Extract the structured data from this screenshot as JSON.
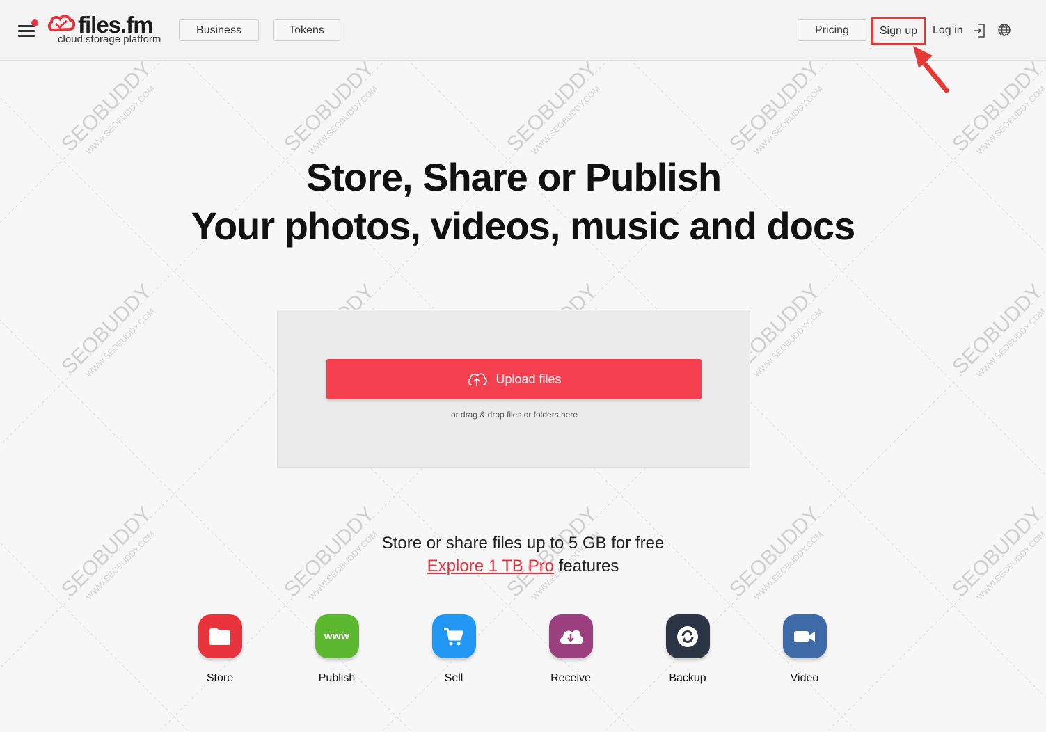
{
  "brand": {
    "name": "files.fm",
    "tagline": "cloud storage platform",
    "accent_color": "#f4404f"
  },
  "header": {
    "menu_icon": "hamburger-menu-icon",
    "nav_left": [
      "Business",
      "Tokens"
    ],
    "pricing": "Pricing",
    "signup": "Sign up",
    "login": "Log in",
    "login_icon": "login-arrow-icon",
    "language_icon": "globe-icon"
  },
  "hero": {
    "line1": "Store, Share or Publish",
    "line2": "Your photos, videos, music and docs"
  },
  "upload": {
    "button_label": "Upload files",
    "button_icon": "cloud-upload-icon",
    "hint": "or drag & drop files or folders here"
  },
  "promo": {
    "line1": "Store or share files up to 5 GB for free",
    "link_text": "Explore 1 TB Pro",
    "link_suffix": " features"
  },
  "features": [
    {
      "label": "Store",
      "icon": "folder-icon",
      "color": "#e8333d"
    },
    {
      "label": "Publish",
      "icon": "www-icon",
      "color": "#5cb82e"
    },
    {
      "label": "Sell",
      "icon": "cart-icon",
      "color": "#2196f3"
    },
    {
      "label": "Receive",
      "icon": "cloud-download-icon",
      "color": "#9c3f7f"
    },
    {
      "label": "Backup",
      "icon": "sync-icon",
      "color": "#2b3545"
    },
    {
      "label": "Video",
      "icon": "video-camera-icon",
      "color": "#3f6aa8"
    }
  ],
  "watermark": {
    "main": "SEOBUDDY",
    "sub": "WWW.SEOBUDDY.COM"
  }
}
